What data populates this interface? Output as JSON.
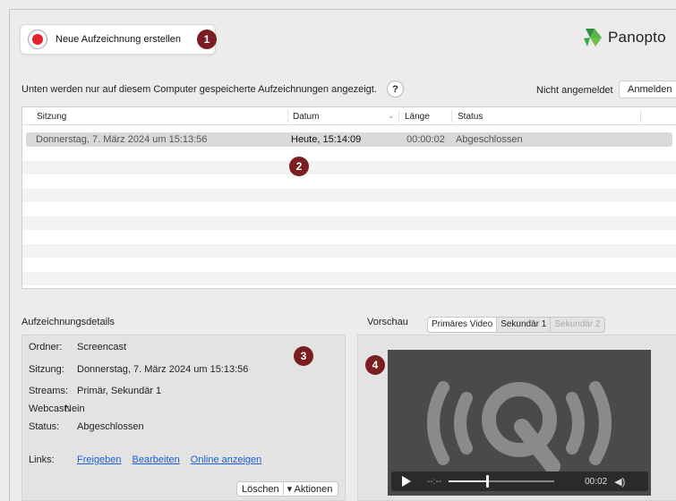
{
  "toolbar": {
    "new_recording_label": "Neue Aufzeichnung erstellen"
  },
  "brand": {
    "name": "Panopto"
  },
  "markers": [
    "1",
    "2",
    "3",
    "4"
  ],
  "info": {
    "text": "Unten werden nur auf diesem Computer gespeicherte Aufzeichnungen angezeigt.",
    "help": "?",
    "login_status": "Nicht angemeldet",
    "login_button": "Anmelden"
  },
  "table": {
    "columns": [
      "Sitzung",
      "Datum",
      "Länge",
      "Status"
    ],
    "rows": [
      {
        "session": "Donnerstag, 7. März 2024 um 15:13:56",
        "date": "Heute, 15:14:09",
        "length": "00:00:02",
        "status": "Abgeschlossen"
      }
    ]
  },
  "details": {
    "label": "Aufzeichnungsdetails",
    "fields": [
      {
        "key": "Ordner:",
        "value": "Screencast"
      },
      {
        "key": "Sitzung:",
        "value": "Donnerstag, 7. März 2024 um 15:13:56"
      },
      {
        "key": "Streams:",
        "value": "Primär, Sekundär 1"
      },
      {
        "key": "Webcast:",
        "value": "Nein"
      },
      {
        "key": "Status:",
        "value": "Abgeschlossen"
      }
    ],
    "links_label": "Links:",
    "links": [
      "Freigeben",
      "Bearbeiten",
      "Online anzeigen"
    ],
    "delete_label": "Löschen",
    "actions_label": "Aktionen"
  },
  "preview": {
    "label": "Vorschau",
    "tabs": [
      "Primäres Video",
      "Sekundär 1",
      "Sekundär 2"
    ],
    "time_elapsed": "--:--",
    "time_total": "00:02"
  },
  "colors": {
    "record": "#e3232b",
    "marker": "#7a1e22",
    "link": "#1a5fd6",
    "logo_green": "#3aa84a"
  }
}
